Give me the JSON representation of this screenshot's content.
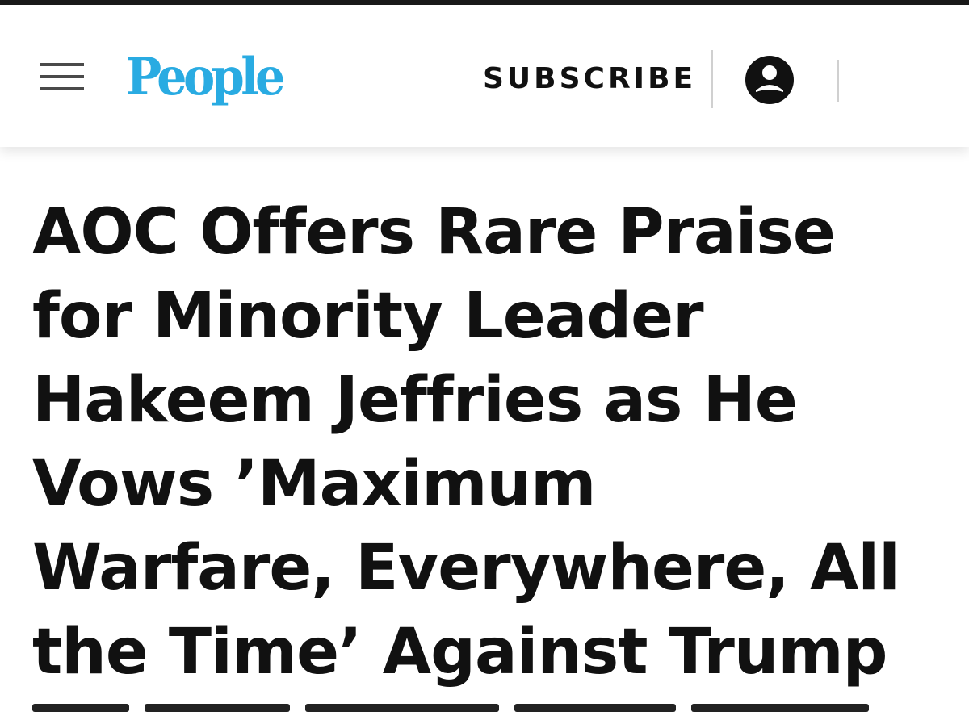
{
  "header": {
    "menu_icon": "hamburger-menu-icon",
    "logo_text": "People",
    "subscribe_label": "SUBSCRIBE",
    "account_icon": "account-icon"
  },
  "article": {
    "headline_lines": [
      "AOC Offers Rare Praise",
      "for Minority Leader",
      "Hakeem Jeffries as He",
      "Vows ’Maximum",
      "Warfare, Everywhere, All",
      "the Time’ Against Trump"
    ]
  },
  "colors": {
    "brand": "#29abe2",
    "text": "#111111",
    "top_rule": "#1a1a1a",
    "divider": "#d0d0d0"
  }
}
